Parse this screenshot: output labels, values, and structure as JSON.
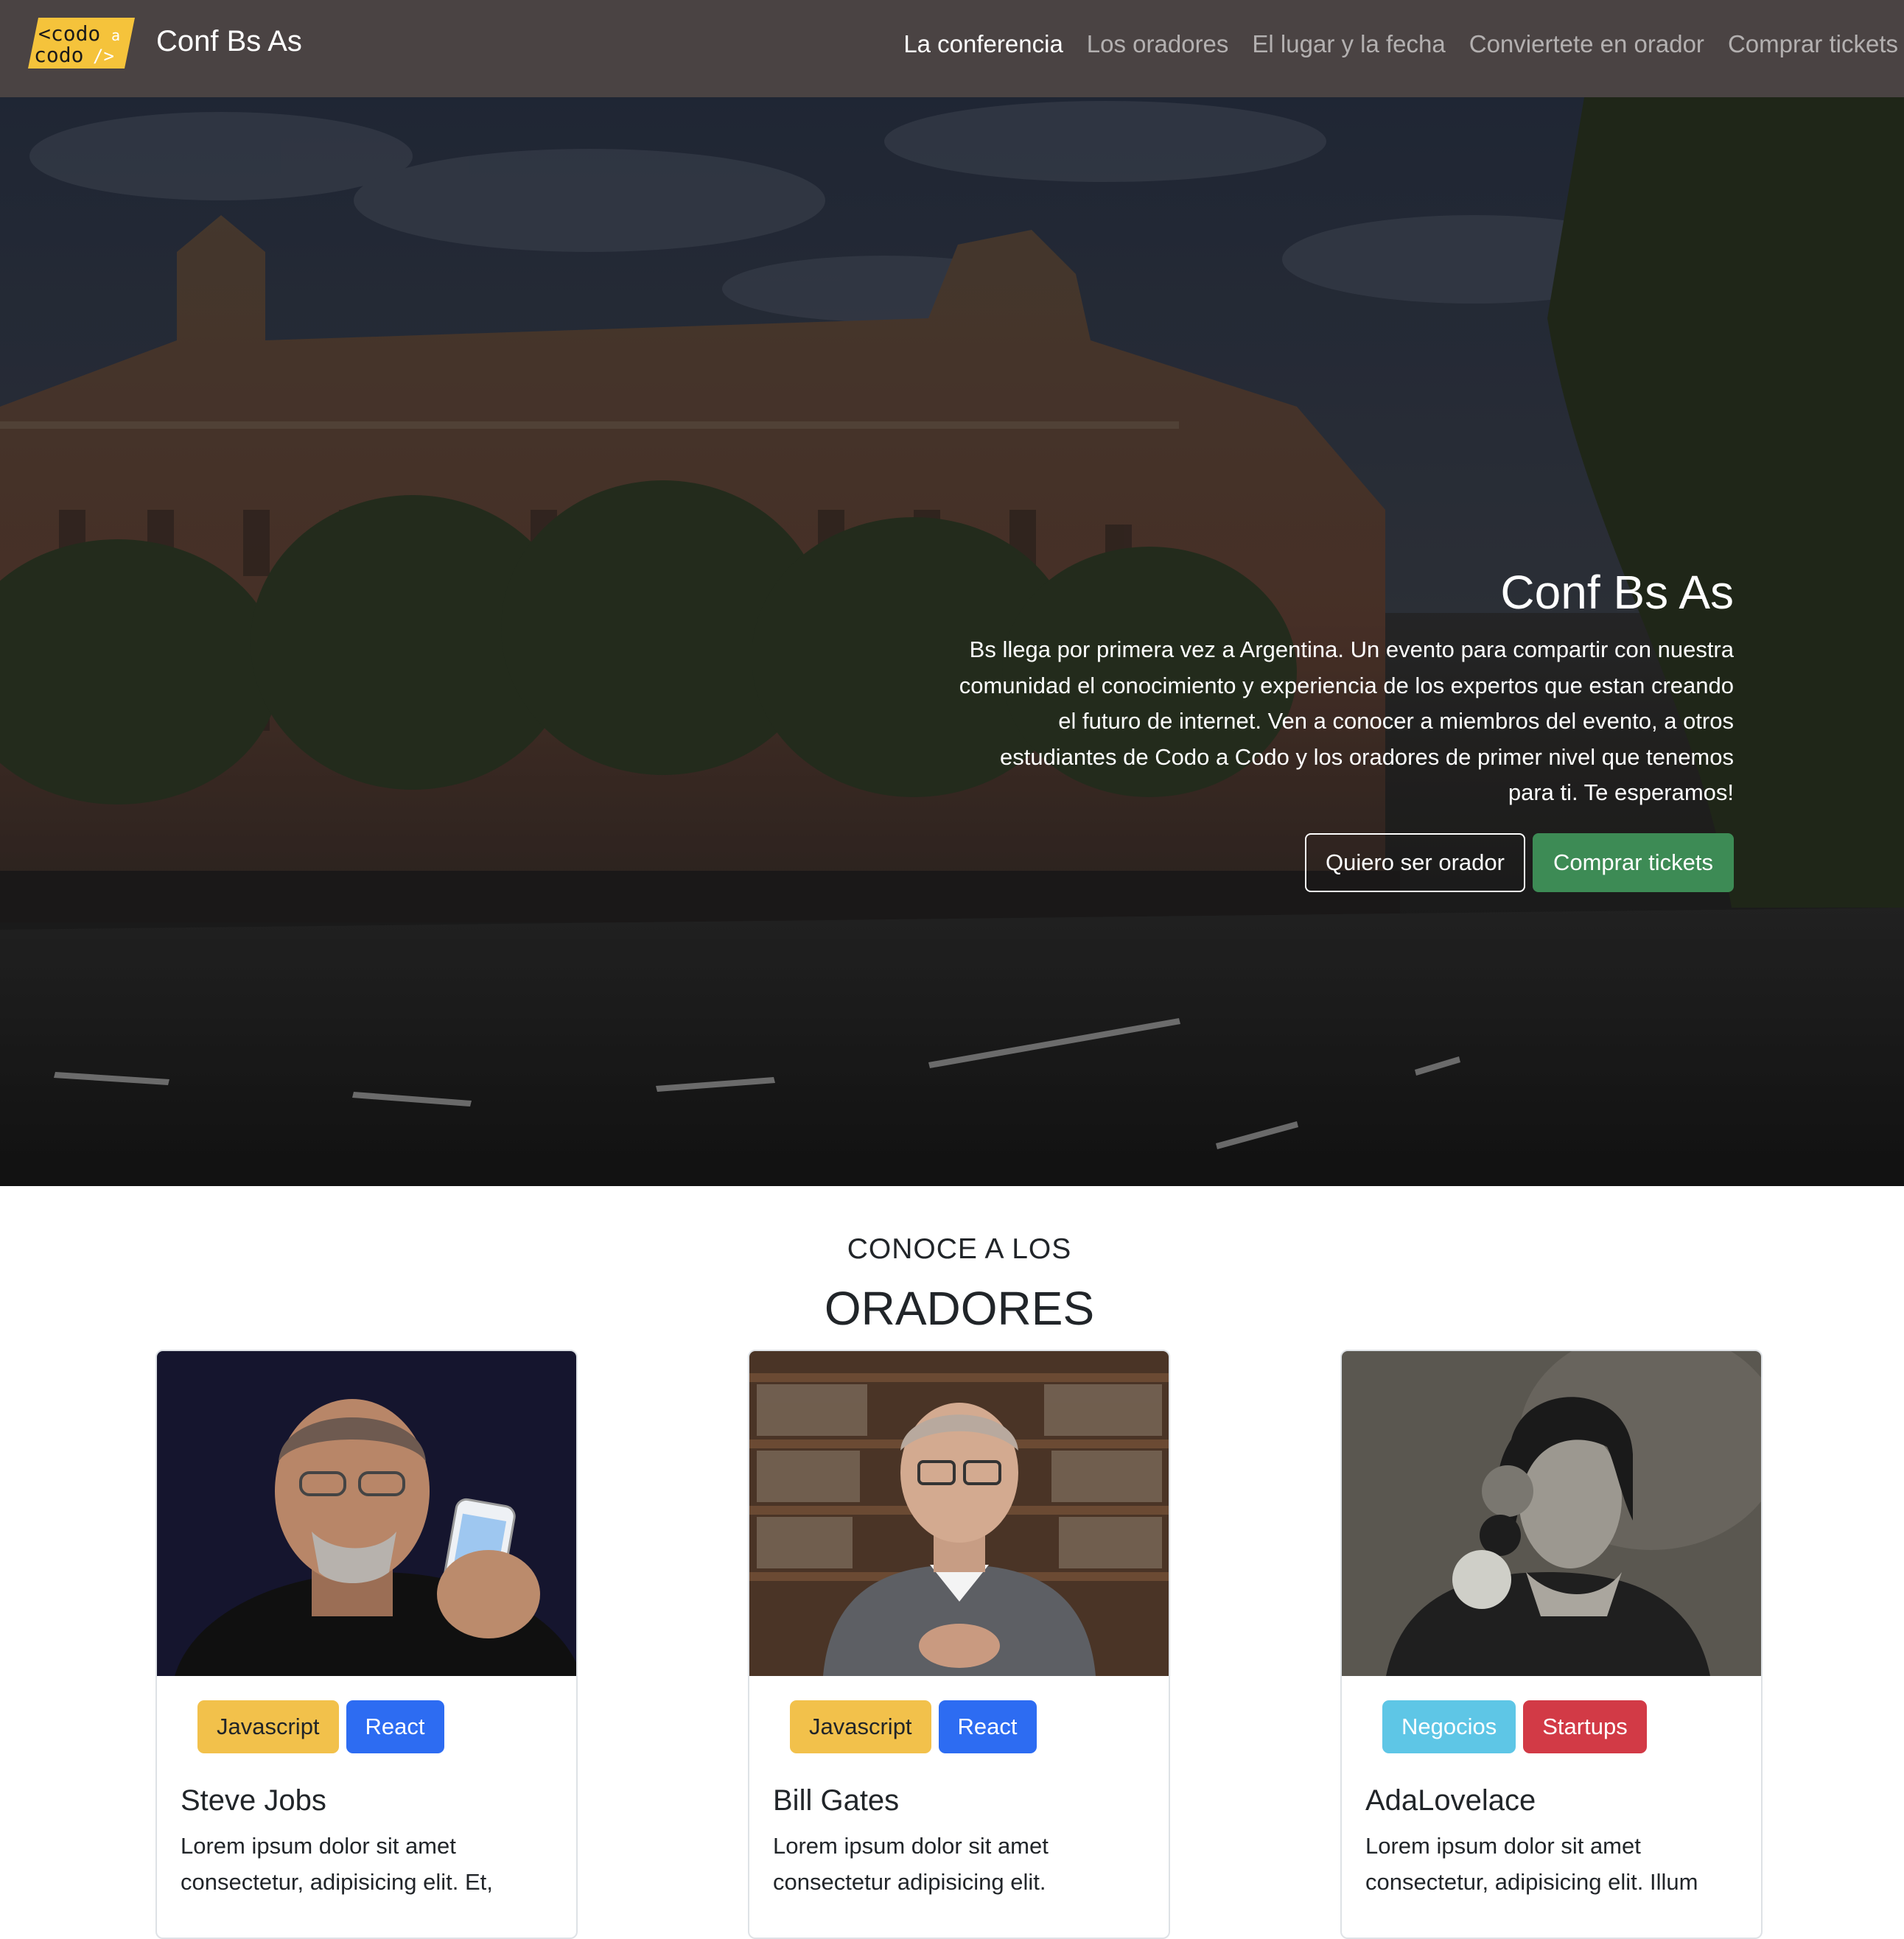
{
  "navbar": {
    "logo_text": [
      "<codo",
      "a",
      "codo",
      "/>"
    ],
    "brand": "Conf Bs As",
    "links": [
      {
        "label": "La conferencia",
        "active": true
      },
      {
        "label": "Los oradores",
        "active": false
      },
      {
        "label": "El lugar y la fecha",
        "active": false
      },
      {
        "label": "Conviertete en orador",
        "active": false
      },
      {
        "label": "Comprar tickets",
        "active": false
      }
    ]
  },
  "hero": {
    "title": "Conf Bs As",
    "text": "Bs llega por primera vez a Argentina. Un evento para compartir con nuestra comunidad el conocimiento y experiencia de los expertos que estan creando el futuro de internet. Ven a conocer a miembros del evento, a otros estudiantes de Codo a Codo y los oradores de primer nivel que tenemos para ti. Te esperamos!",
    "button_outline": "Quiero ser orador",
    "button_primary": "Comprar tickets"
  },
  "speakers": {
    "eyebrow": "CONOCE A LOS",
    "title": "ORADORES",
    "cards": [
      {
        "name": "Steve Jobs",
        "badges": [
          "Javascript",
          "React"
        ],
        "text": "Lorem ipsum dolor sit amet consectetur, adipisicing elit. Et,"
      },
      {
        "name": "Bill Gates",
        "badges": [
          "Javascript",
          "React"
        ],
        "text": "Lorem ipsum dolor sit amet consectetur adipisicing elit."
      },
      {
        "name": "AdaLovelace",
        "badges": [
          "Negocios",
          "Startups"
        ],
        "text": "Lorem ipsum dolor sit amet consectetur, adipisicing elit. Illum"
      }
    ]
  },
  "colors": {
    "navbar_bg": "#4a4343",
    "success": "#3d8b55",
    "badge_yellow": "#f2c14b",
    "badge_blue": "#2d6cf2",
    "badge_cyan": "#5ec6e6",
    "badge_red": "#d23a46"
  }
}
